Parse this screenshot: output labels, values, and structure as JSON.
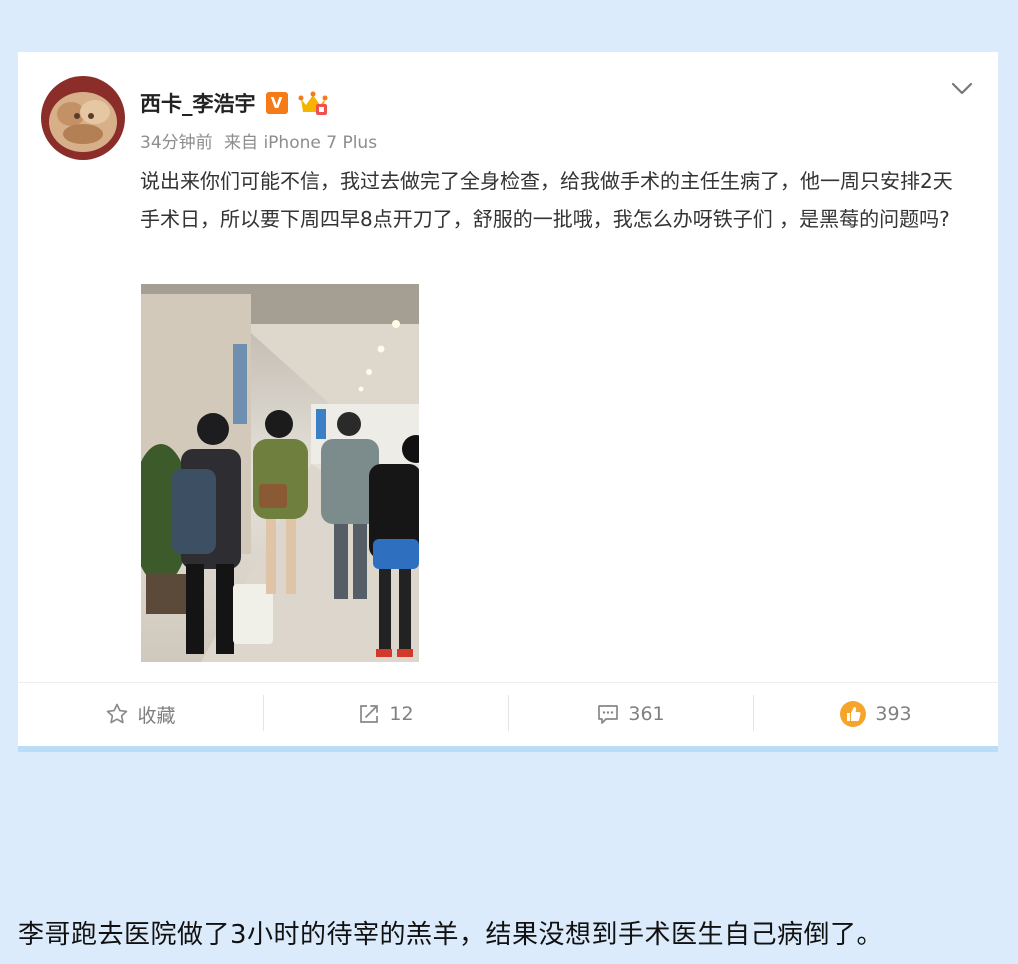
{
  "post": {
    "username": "西卡_李浩宇",
    "verified_badge": "V",
    "time": "34分钟前",
    "source": "来自 iPhone 7 Plus",
    "text": "说出来你们可能不信，我过去做完了全身检查，给我做手术的主任生病了，他一周只安排2天手术日，所以要下周四早8点开刀了，舒服的一批哦，我怎么办呀铁子们 ，是黑莓的问题吗?",
    "icons": {
      "verified": "verified-v-badge-icon",
      "crown": "vip-crown-icon",
      "dropdown": "chevron-down-icon"
    }
  },
  "actions": {
    "favorite_label": "收藏",
    "repost_count": "12",
    "comment_count": "361",
    "like_count": "393"
  },
  "caption": "李哥跑去医院做了3小时的待宰的羔羊，结果没想到手术医生自己病倒了。",
  "colors": {
    "background": "#dcebfb",
    "accent_orange": "#f57a18",
    "card_bottom_bar": "#b9dcf7"
  }
}
